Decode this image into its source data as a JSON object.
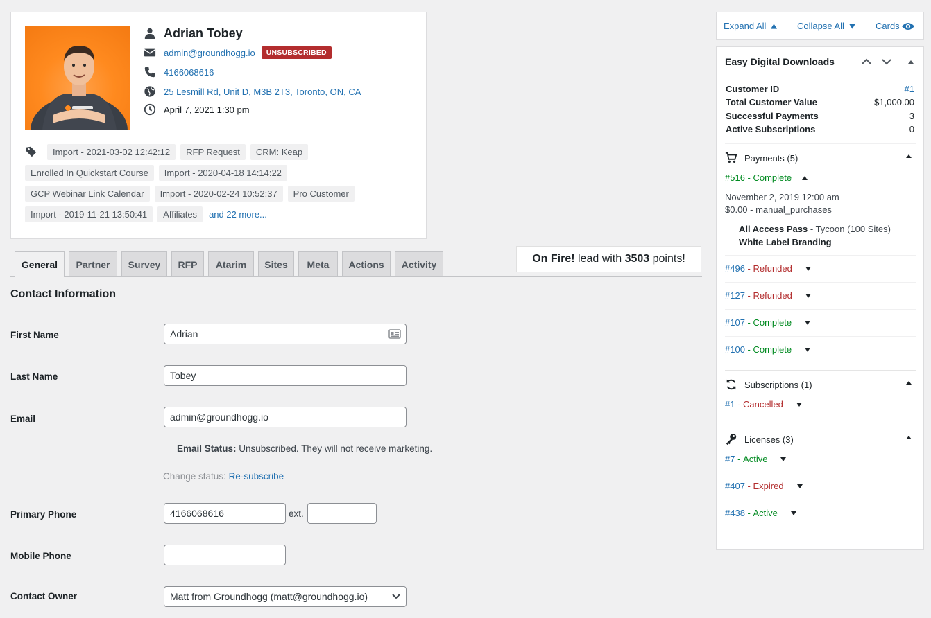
{
  "contact": {
    "name": "Adrian Tobey",
    "email": "admin@groundhogg.io",
    "status_badge": "UNSUBSCRIBED",
    "phone": "4166068616",
    "address": "25 Lesmill Rd, Unit D, M3B 2T3, Toronto, ON, CA",
    "date": "April 7, 2021 1:30 pm"
  },
  "tags": {
    "lines": [
      [
        "Import - 2021-03-02 12:42:12",
        "RFP Request",
        "CRM: Keap"
      ],
      [
        "Enrolled In Quickstart Course",
        "Import - 2020-04-18 14:14:22"
      ],
      [
        "GCP Webinar Link Calendar",
        "Import - 2020-02-24 10:52:37",
        "Pro Customer"
      ],
      [
        "Import - 2019-11-21 13:50:41",
        "Affiliates"
      ]
    ],
    "more_link": "and 22 more..."
  },
  "tabs": [
    "General",
    "Partner",
    "Survey",
    "RFP",
    "Atarim",
    "Sites",
    "Meta",
    "Actions",
    "Activity"
  ],
  "onfire": {
    "status": "On Fire!",
    "mid": " lead with ",
    "points": "3503",
    "suffix": " points!"
  },
  "form": {
    "section_title": "Contact Information",
    "first_name_label": "First Name",
    "first_name": "Adrian",
    "last_name_label": "Last Name",
    "last_name": "Tobey",
    "email_label": "Email",
    "email": "admin@groundhogg.io",
    "email_status_label": "Email Status:",
    "email_status_text": " Unsubscribed. They will not receive marketing.",
    "change_status_label": "Change status: ",
    "resubscribe": "Re-subscribe",
    "primary_phone_label": "Primary Phone",
    "primary_phone": "4166068616",
    "ext_label": "ext.",
    "ext": "",
    "mobile_phone_label": "Mobile Phone",
    "mobile_phone": "",
    "owner_label": "Contact Owner",
    "owner": "Matt from Groundhogg (matt@groundhogg.io)"
  },
  "toolbar": {
    "expand_all": "Expand All",
    "collapse_all": "Collapse All",
    "cards": "Cards"
  },
  "edd": {
    "title": "Easy Digital Downloads",
    "stats": [
      {
        "k": "Customer ID",
        "v": "#1"
      },
      {
        "k": "Total Customer Value",
        "v": "$1,000.00"
      },
      {
        "k": "Successful Payments",
        "v": "3"
      },
      {
        "k": "Active Subscriptions",
        "v": "0"
      }
    ],
    "payments_title": "Payments (5)",
    "payments": [
      {
        "num": "#516",
        "status": "Complete"
      },
      {
        "num": "#496",
        "status": "Refunded"
      },
      {
        "num": "#127",
        "status": "Refunded"
      },
      {
        "num": "#107",
        "status": "Complete"
      },
      {
        "num": "#100",
        "status": "Complete"
      }
    ],
    "payment_detail": {
      "date": "November 2, 2019 12:00 am",
      "amount": "$0.00 - manual_purchases",
      "product_name": "All Access Pass",
      "product_variant": " - Tycoon (100 Sites)",
      "product2": "White Label Branding"
    },
    "subscriptions_title": "Subscriptions (1)",
    "subscriptions": [
      {
        "num": "#1",
        "status": "Cancelled"
      }
    ],
    "licenses_title": "Licenses (3)",
    "licenses": [
      {
        "num": "#7",
        "status": "Active"
      },
      {
        "num": "#407",
        "status": "Expired"
      },
      {
        "num": "#438",
        "status": "Active"
      }
    ]
  },
  "colors": {
    "link": "#2271b1",
    "badge": "#b32d2e",
    "complete": "#008a20",
    "refunded": "#b32d2e",
    "avatar_bg": "#ff8a1f"
  }
}
